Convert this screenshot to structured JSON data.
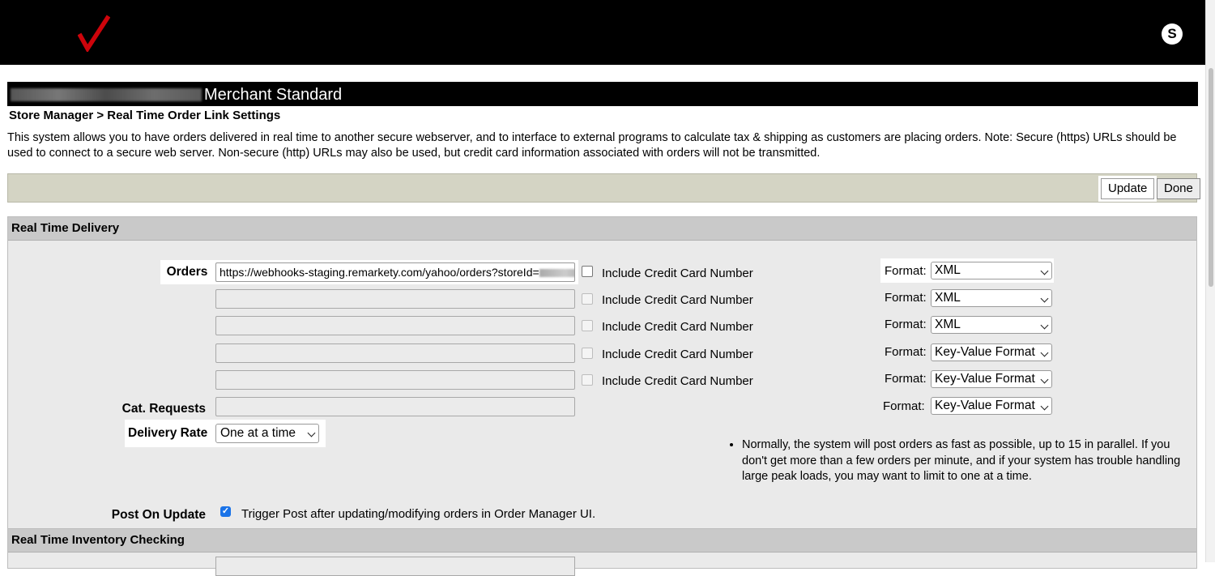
{
  "header": {
    "logo_icon": "verizon-check-icon",
    "accent_color": "#cd040b",
    "avatar_initial": "S"
  },
  "store": {
    "plan": "Merchant Standard"
  },
  "breadcrumb": "Store Manager > Real Time Order Link Settings",
  "intro_text": "This system allows you to have orders delivered in real time to another secure webserver, and to interface to external programs to calculate tax & shipping as customers are placing orders. Note: Secure (https) URLs should be used to connect to a secure web server. Non-secure (http) URLs may also be used, but credit card information associated with orders will not be transmitted.",
  "actions": {
    "update": "Update",
    "done": "Done"
  },
  "delivery": {
    "title": "Real Time Delivery",
    "orders_label": "Orders",
    "cat_requests_label": "Cat. Requests",
    "delivery_rate_label": "Delivery Rate",
    "include_cc_label": "Include Credit Card Number",
    "format_label": "Format:",
    "rows": [
      {
        "url": "https://webhooks-staging.remarkety.com/yahoo/orders?storeId=",
        "format": "XML"
      },
      {
        "url": "",
        "format": "XML"
      },
      {
        "url": "",
        "format": "XML"
      },
      {
        "url": "",
        "format": "Key-Value Format"
      },
      {
        "url": "",
        "format": "Key-Value Format"
      }
    ],
    "cat_requests": {
      "url": "",
      "format": "Key-Value Format"
    },
    "delivery_rate": "One at a time",
    "note": "Normally, the system will post orders as fast as possible, up to 15 in parallel. If you don't get more than a few orders per minute, and if your system has trouble handling large peak loads, you may want to limit to one at a time.",
    "post_on_update_label": "Post On Update",
    "post_on_update_text": "Trigger Post after updating/modifying orders in Order Manager UI.",
    "post_on_update_checked": true
  },
  "inventory": {
    "title": "Real Time Inventory Checking"
  }
}
